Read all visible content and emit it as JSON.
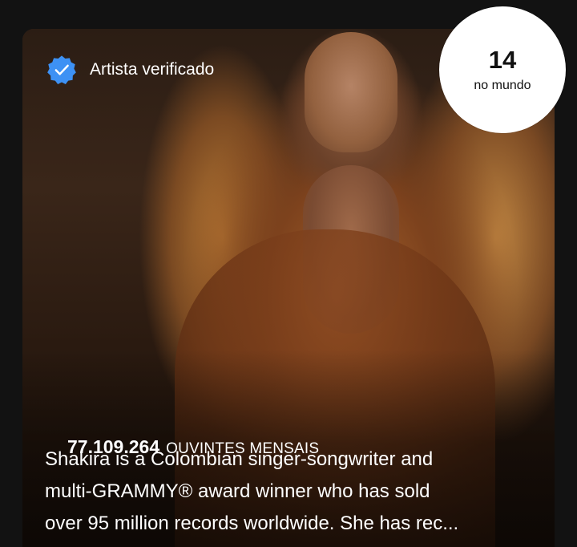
{
  "artist_card": {
    "verified_label": "Artista verificado",
    "rank": {
      "number": "14",
      "label": "no mundo"
    },
    "monthly_listeners": {
      "count": "77.109.264",
      "label": "OUVINTES MENSAIS"
    },
    "bio": {
      "line1": "Shakira is a Colombian singer-songwriter and",
      "line2": "multi-GRAMMY® award winner who has sold",
      "line3": "over 95 million records worldwide. She has rec..."
    }
  },
  "colors": {
    "background": "#121212",
    "verified_badge": "#3d91f4",
    "rank_circle": "#ffffff",
    "text": "#ffffff"
  },
  "icons": {
    "verified": "verified-badge-icon"
  }
}
